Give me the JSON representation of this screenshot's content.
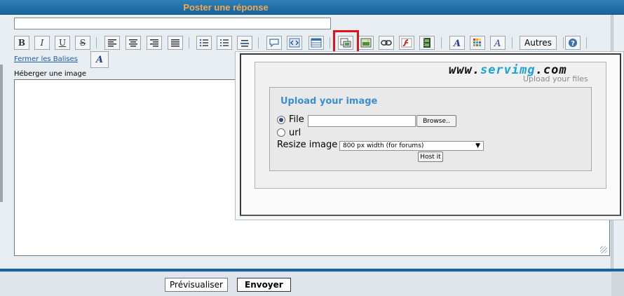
{
  "header": {
    "title": "Poster une réponse"
  },
  "toolbar": {
    "buttons": [
      {
        "name": "bold-button",
        "icon": "bold-icon",
        "glyph": "B"
      },
      {
        "name": "italic-button",
        "icon": "italic-icon",
        "glyph": "I"
      },
      {
        "name": "underline-button",
        "icon": "underline-icon",
        "glyph": "U"
      },
      {
        "name": "strike-button",
        "icon": "strikethrough-icon",
        "glyph": "S"
      }
    ],
    "more_label": "Autres"
  },
  "editor": {
    "close_tags_label": "Fermer les Balises",
    "font_button_glyph": "A",
    "host_image_label": "Héberger une image"
  },
  "popup": {
    "logo_left": "www.",
    "logo_mid": "servimg",
    "logo_right": ".com",
    "tagline": "Upload your files",
    "title": "Upload your image",
    "file_label": "File",
    "url_label": "url",
    "browse_label": "Browse..",
    "resize_label": "Resize image",
    "resize_value": "800 px width (for forums)",
    "host_label": "Host it",
    "selected_option": "File"
  },
  "footer": {
    "preview_label": "Prévisualiser",
    "send_label": "Envoyer"
  },
  "colors": {
    "header_bg": "#17649e",
    "header_text": "#f5a94a",
    "highlight": "#e0121b",
    "upload_title": "#3a8fd0",
    "logo_accent": "#1aa3d8"
  }
}
